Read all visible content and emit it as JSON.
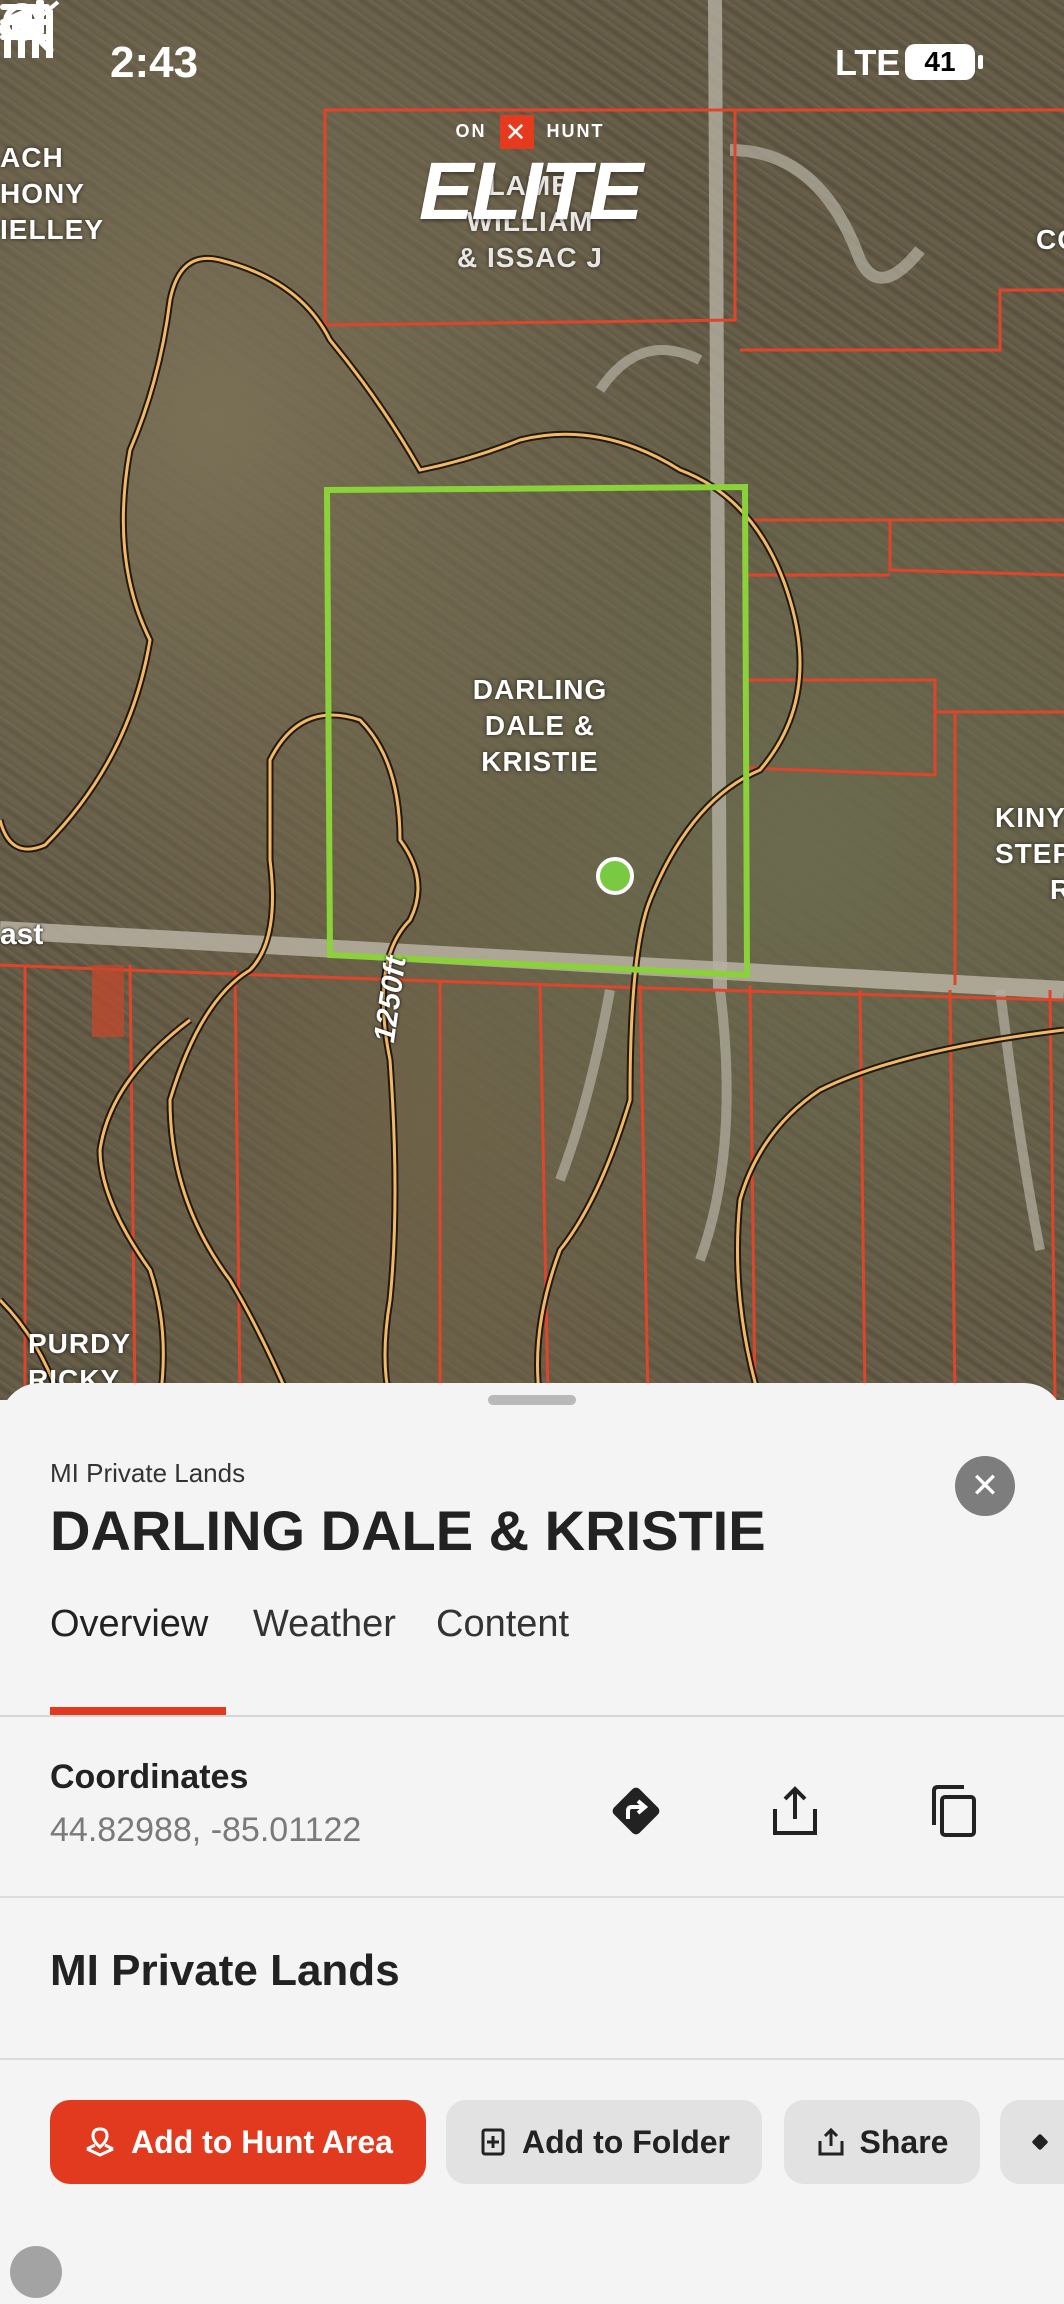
{
  "status_bar": {
    "time": "2:43",
    "network": "LTE",
    "battery": "41"
  },
  "brand": {
    "top_left": "ON",
    "top_x": "✕",
    "top_right": "HUNT",
    "main": "ELITE"
  },
  "map": {
    "parcel_selected_label": [
      "DARLING",
      "DALE &",
      "KRISTIE"
    ],
    "parcel_top_label": [
      "LAMB",
      "WILLIAM",
      "& ISSAC J"
    ],
    "parcel_left_label": [
      "ACH",
      "HONY",
      "IELLEY"
    ],
    "parcel_right_label": [
      "KINY",
      "STEP",
      "R"
    ],
    "parcel_right_top_label": "CO",
    "parcel_bottom_left_label": [
      "PURDY",
      "RICKY L"
    ],
    "road_label": "ast",
    "scale_label": "1250ft"
  },
  "sheet": {
    "category": "MI Private Lands",
    "title": "DARLING DALE & KRISTIE",
    "close_icon": "✕",
    "tabs": [
      {
        "label": "Overview",
        "active": true
      },
      {
        "label": "Weather",
        "active": false
      },
      {
        "label": "Content",
        "active": false
      }
    ],
    "coordinates": {
      "label": "Coordinates",
      "value": "44.82988, -85.01122"
    },
    "section_title": "MI Private Lands",
    "actions": [
      {
        "label": "Add to Hunt Area",
        "icon": "hunt-area-icon"
      },
      {
        "label": "Add to Folder",
        "icon": "folder-add-icon"
      },
      {
        "label": "Share",
        "icon": "share-icon"
      }
    ]
  },
  "colors": {
    "accent": "#e23a1f",
    "parcel_outline": "#e0442a",
    "selected_parcel": "#8bd13a",
    "contour": "#f2b86a",
    "pin": "#7ac943"
  }
}
